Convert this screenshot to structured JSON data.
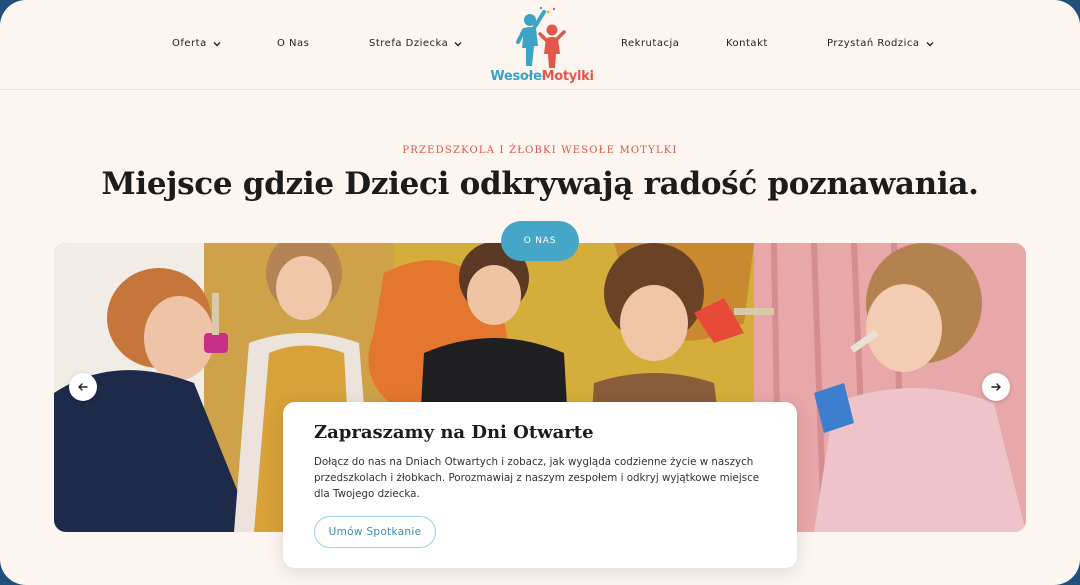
{
  "nav": {
    "items": [
      {
        "label": "Oferta",
        "dropdown": true
      },
      {
        "label": "O Nas",
        "dropdown": false
      },
      {
        "label": "Strefa Dziecka",
        "dropdown": true
      },
      {
        "label": "Rekrutacja",
        "dropdown": false
      },
      {
        "label": "Kontakt",
        "dropdown": false
      },
      {
        "label": "Przystań Rodzica",
        "dropdown": true
      }
    ],
    "logo": {
      "part1": "Wesołe",
      "part2": "Motylki"
    }
  },
  "hero": {
    "eyebrow": "PRZEDSZKOLA I ŻŁOBKI WESOŁE MOTYLKI",
    "headline": "Miejsce gdzie Dzieci odkrywają radość poznawania.",
    "cta": "O NAS"
  },
  "slider": {
    "prev_icon": "arrow-left-icon",
    "next_icon": "arrow-right-icon",
    "image": "photo of teacher and children playing with handbells"
  },
  "card": {
    "title": "Zapraszamy na Dni Otwarte",
    "body": "Dołącz do nas na Dniach Otwartych i zobacz, jak wygląda codzienne życie w naszych przedszkolach i żłobkach. Porozmawiaj z naszym zespołem i odkryj wyjątkowe miejsce dla Twojego dziecka.",
    "button": "Umów Spotkanie"
  },
  "colors": {
    "background": "#fdf5ef",
    "accent_blue": "#45a6c8",
    "accent_red": "#d9584f",
    "text_dark": "#1c1c1c"
  }
}
